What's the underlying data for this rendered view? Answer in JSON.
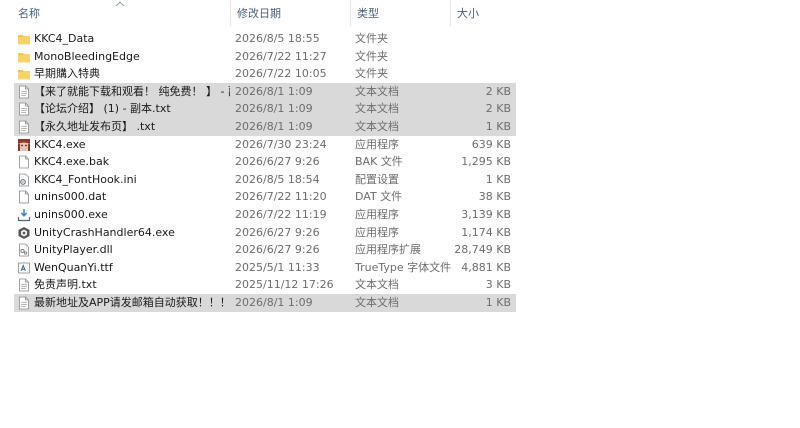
{
  "columns": {
    "name": "名称",
    "date": "修改日期",
    "type": "类型",
    "size": "大小"
  },
  "files": [
    {
      "name": "KKC4_Data",
      "date": "2026/8/5 18:55",
      "type": "文件夹",
      "size": "",
      "icon": "folder-icon",
      "selected": false
    },
    {
      "name": "MonoBleedingEdge",
      "date": "2026/7/22 11:27",
      "type": "文件夹",
      "size": "",
      "icon": "folder-icon",
      "selected": false
    },
    {
      "name": "早期購入特典",
      "date": "2026/7/22 10:05",
      "type": "文件夹",
      "size": "",
      "icon": "folder-icon",
      "selected": false
    },
    {
      "name": "【来了就能下载和观看！ 纯免费！ 】 - 副...",
      "date": "2026/8/1 1:09",
      "type": "文本文档",
      "size": "2 KB",
      "icon": "text-file-icon",
      "selected": true
    },
    {
      "name": "【论坛介绍】 (1) - 副本.txt",
      "date": "2026/8/1 1:09",
      "type": "文本文档",
      "size": "2 KB",
      "icon": "text-file-icon",
      "selected": true
    },
    {
      "name": "【永久地址发布页】 .txt",
      "date": "2026/8/1 1:09",
      "type": "文本文档",
      "size": "1 KB",
      "icon": "text-file-icon",
      "selected": true
    },
    {
      "name": "KKC4.exe",
      "date": "2026/7/30 23:24",
      "type": "应用程序",
      "size": "639 KB",
      "icon": "app-avatar-icon",
      "selected": false
    },
    {
      "name": "KKC4.exe.bak",
      "date": "2026/6/27 9:26",
      "type": "BAK 文件",
      "size": "1,295 KB",
      "icon": "blank-file-icon",
      "selected": false
    },
    {
      "name": "KKC4_FontHook.ini",
      "date": "2026/8/5 18:54",
      "type": "配置设置",
      "size": "1 KB",
      "icon": "config-file-icon",
      "selected": false
    },
    {
      "name": "unins000.dat",
      "date": "2026/7/22 11:20",
      "type": "DAT 文件",
      "size": "38 KB",
      "icon": "blank-file-icon",
      "selected": false
    },
    {
      "name": "unins000.exe",
      "date": "2026/7/22 11:19",
      "type": "应用程序",
      "size": "3,139 KB",
      "icon": "installer-icon",
      "selected": false
    },
    {
      "name": "UnityCrashHandler64.exe",
      "date": "2026/6/27 9:26",
      "type": "应用程序",
      "size": "1,174 KB",
      "icon": "unity-icon",
      "selected": false
    },
    {
      "name": "UnityPlayer.dll",
      "date": "2026/6/27 9:26",
      "type": "应用程序扩展",
      "size": "28,749 KB",
      "icon": "dll-file-icon",
      "selected": false
    },
    {
      "name": "WenQuanYi.ttf",
      "date": "2025/5/1 11:33",
      "type": "TrueType 字体文件",
      "size": "4,881 KB",
      "icon": "font-file-icon",
      "selected": false
    },
    {
      "name": "免责声明.txt",
      "date": "2025/11/12 17:26",
      "type": "文本文档",
      "size": "3 KB",
      "icon": "text-file-icon",
      "selected": false
    },
    {
      "name": "最新地址及APP请发邮箱自动获取！！！...",
      "date": "2026/8/1 1:09",
      "type": "文本文档",
      "size": "1 KB",
      "icon": "text-file-icon",
      "selected": true
    }
  ],
  "colors": {
    "selection": "#d9d9d9",
    "folder": "#f4c44b",
    "header_text": "#4c607a",
    "secondary_text": "#6d6d6d"
  }
}
